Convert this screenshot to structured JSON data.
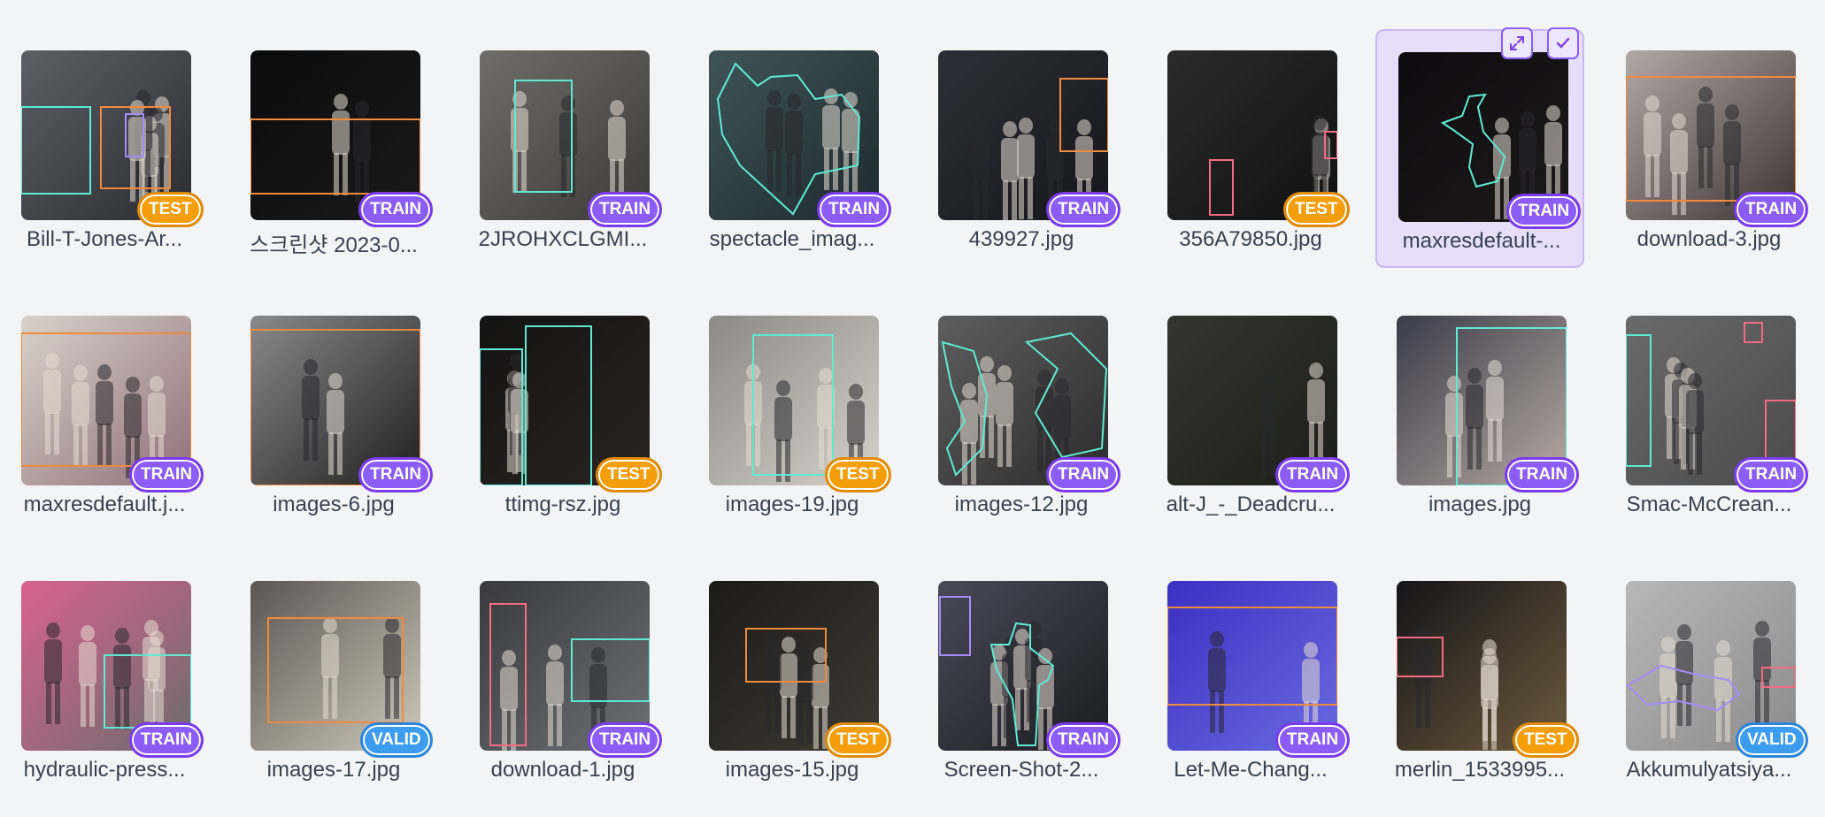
{
  "colors": {
    "background": "#f3f4f6",
    "train": "#8b5cf6",
    "test": "#f59e0b",
    "valid": "#3b9cf0",
    "selected_bg": "#e6defa",
    "box_orange": "#f08a3c",
    "box_teal": "#5eead4",
    "box_pink": "#f26b82",
    "box_purple": "#a78bfa"
  },
  "selected_tile_actions": {
    "expand_icon": "expand-icon",
    "check_icon": "check-icon"
  },
  "images": [
    {
      "name": "Bill-T-Jones-Ar...",
      "split": "TEST",
      "bg": [
        "#5c5f66",
        "#2a2c31"
      ],
      "ann": "teal,orange,purple"
    },
    {
      "name": "스크린샷 2023-0...",
      "split": "TRAIN",
      "bg": [
        "#0b0b0b",
        "#1a1a1a"
      ],
      "ann": "orange"
    },
    {
      "name": "2JROHXCLGMI...",
      "split": "TRAIN",
      "bg": [
        "#6f6d69",
        "#3c3a37"
      ],
      "ann": "teal"
    },
    {
      "name": "spectacle_imag...",
      "split": "TRAIN",
      "bg": [
        "#3f5457",
        "#1c2a2e"
      ],
      "ann": "teal-poly"
    },
    {
      "name": "439927.jpg",
      "split": "TRAIN",
      "bg": [
        "#2d2f38",
        "#15161b"
      ],
      "ann": "orange"
    },
    {
      "name": "356A79850.jpg",
      "split": "TEST",
      "bg": [
        "#2b2b2b",
        "#111111"
      ],
      "ann": "pink"
    },
    {
      "name": "maxresdefault-...",
      "split": "TRAIN",
      "bg": [
        "#0d0b0d",
        "#1d1a1b"
      ],
      "ann": "teal-poly",
      "selected": true
    },
    {
      "name": "download-3.jpg",
      "split": "TRAIN",
      "bg": [
        "#b2a9a6",
        "#3d3232"
      ],
      "ann": "orange"
    },
    {
      "name": "maxresdefault.j...",
      "split": "TRAIN",
      "bg": [
        "#d9d3ca",
        "#8f6f78"
      ],
      "ann": "orange"
    },
    {
      "name": "images-6.jpg",
      "split": "TRAIN",
      "bg": [
        "#8a8a8a",
        "#1e1e1e"
      ],
      "ann": "orange"
    },
    {
      "name": "ttimg-rsz.jpg",
      "split": "TEST",
      "bg": [
        "#131313",
        "#2a2420"
      ],
      "ann": "teal"
    },
    {
      "name": "images-19.jpg",
      "split": "TEST",
      "bg": [
        "#8c8a86",
        "#d6d2ca"
      ],
      "ann": "teal"
    },
    {
      "name": "images-12.jpg",
      "split": "TRAIN",
      "bg": [
        "#5e5e5e",
        "#2b2b2b"
      ],
      "ann": "teal-poly"
    },
    {
      "name": "alt-J_-_Deadcru...",
      "split": "TRAIN",
      "bg": [
        "#34352e",
        "#1d1e19"
      ],
      "ann": "none"
    },
    {
      "name": "images.jpg",
      "split": "TRAIN",
      "bg": [
        "#3a3b4a",
        "#b7aaa1"
      ],
      "ann": "teal"
    },
    {
      "name": "Smac-McCrean...",
      "split": "TRAIN",
      "bg": [
        "#6a6a6a",
        "#4a4a4a"
      ],
      "ann": "teal,pink"
    },
    {
      "name": "hydraulic-press...",
      "split": "TRAIN",
      "bg": [
        "#d8628f",
        "#6c6c6c"
      ],
      "ann": "teal"
    },
    {
      "name": "images-17.jpg",
      "split": "VALID",
      "bg": [
        "#5a5650",
        "#cfc8bc"
      ],
      "ann": "orange"
    },
    {
      "name": "download-1.jpg",
      "split": "TRAIN",
      "bg": [
        "#3a3a3d",
        "#6c6f73"
      ],
      "ann": "pink,teal"
    },
    {
      "name": "images-15.jpg",
      "split": "TEST",
      "bg": [
        "#1c1b17",
        "#3b3a32"
      ],
      "ann": "orange"
    },
    {
      "name": "Screen-Shot-2...",
      "split": "TRAIN",
      "bg": [
        "#4a4a58",
        "#1a1a20"
      ],
      "ann": "purple,teal-poly"
    },
    {
      "name": "Let-Me-Chang...",
      "split": "TRAIN",
      "bg": [
        "#3b2fc2",
        "#6a6ae0"
      ],
      "ann": "orange"
    },
    {
      "name": "merlin_1533995...",
      "split": "TEST",
      "bg": [
        "#151418",
        "#6c5a3c"
      ],
      "ann": "pink"
    },
    {
      "name": "Akkumulyatsiya...",
      "split": "VALID",
      "bg": [
        "#b7b7b7",
        "#8c8c8c"
      ],
      "ann": "purple-poly,pink"
    }
  ]
}
